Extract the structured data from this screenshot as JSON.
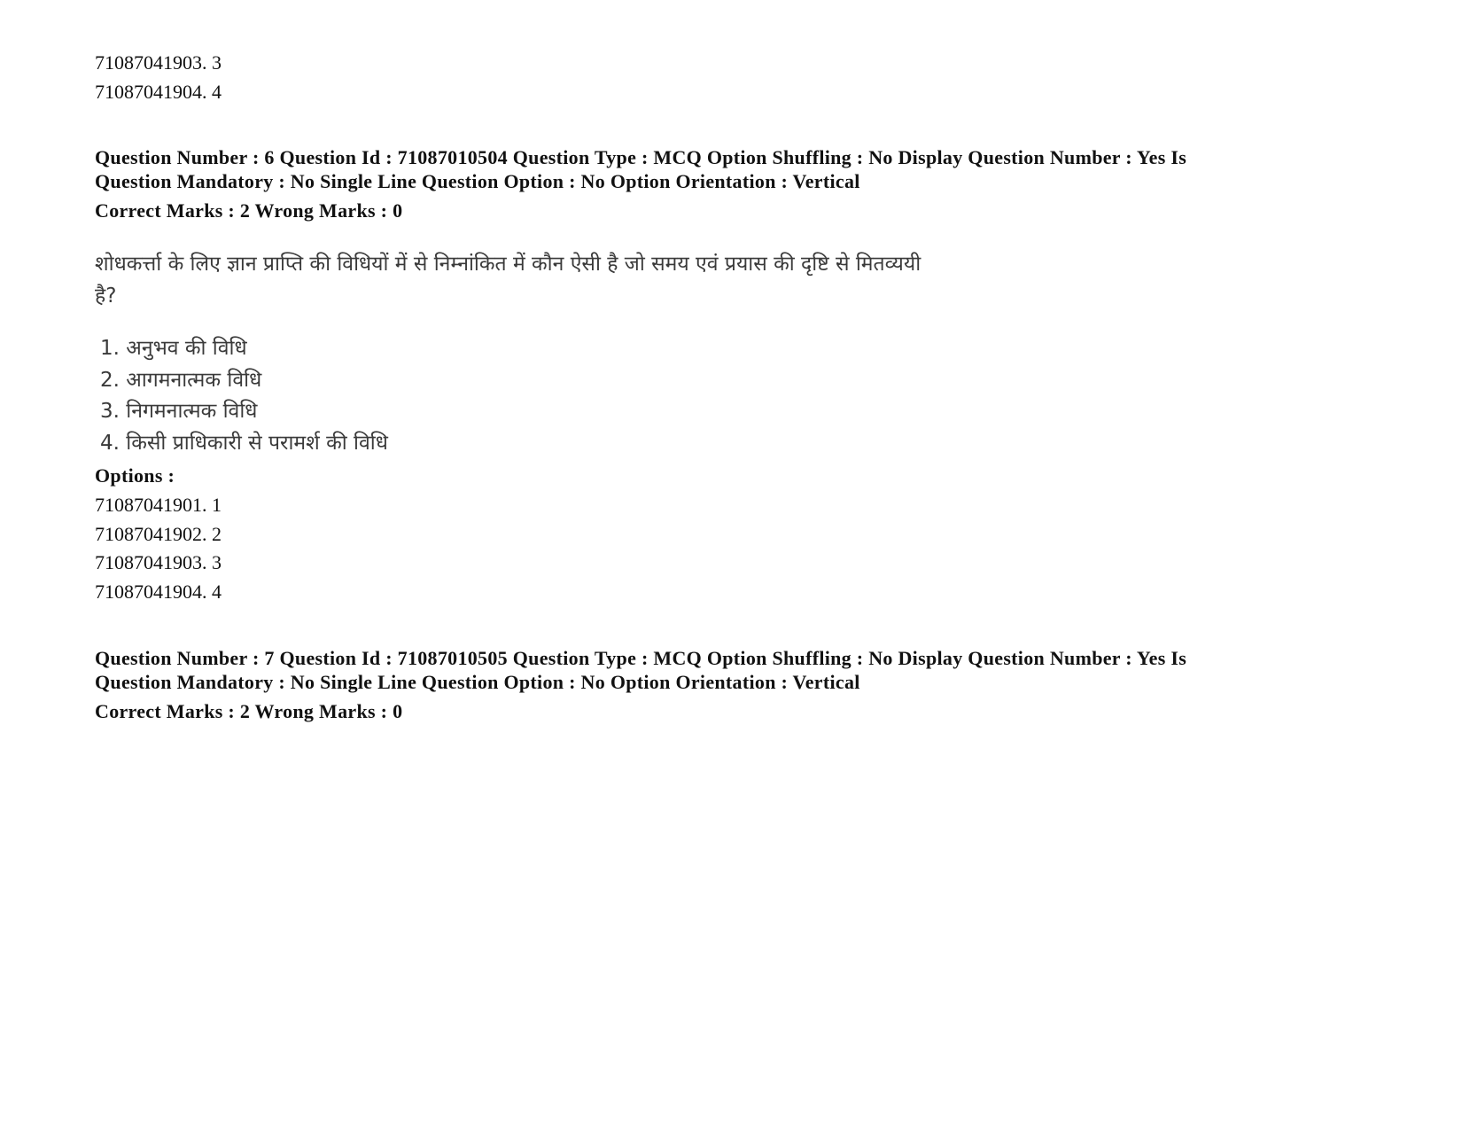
{
  "prev_question": {
    "options": [
      {
        "id": "71087041903",
        "value": "3",
        "text": "71087041903. 3"
      },
      {
        "id": "71087041904",
        "value": "4",
        "text": "71087041904. 4"
      }
    ]
  },
  "question6": {
    "meta_line1": "Question Number : 6 Question Id : 71087010504 Question Type : MCQ Option Shuffling : No Display Question Number : Yes Is",
    "meta_line2": "Question Mandatory : No Single Line Question Option : No Option Orientation : Vertical",
    "marks": "Correct Marks : 2 Wrong Marks : 0",
    "question_text_line1": "शोधकर्त्ता के लिए ज्ञान प्राप्ति की विधियों में से निम्नांकित में कौन ऐसी है जो समय एवं प्रयास की दृष्टि से मितव्ययी",
    "question_text_line2": "है?",
    "choices": [
      "1. अनुभव की विधि",
      "2. आगमनात्मक विधि",
      "3. निगमनात्मक विधि",
      "4. किसी प्राधिकारी से परामर्श की विधि"
    ],
    "options_label": "Options :",
    "options": [
      "71087041901. 1",
      "71087041902. 2",
      "71087041903. 3",
      "71087041904. 4"
    ]
  },
  "question7": {
    "meta_line1": "Question Number : 7 Question Id : 71087010505 Question Type : MCQ Option Shuffling : No Display Question Number : Yes Is",
    "meta_line2": "Question Mandatory : No Single Line Question Option : No Option Orientation : Vertical",
    "marks": "Correct Marks : 2 Wrong Marks : 0"
  }
}
